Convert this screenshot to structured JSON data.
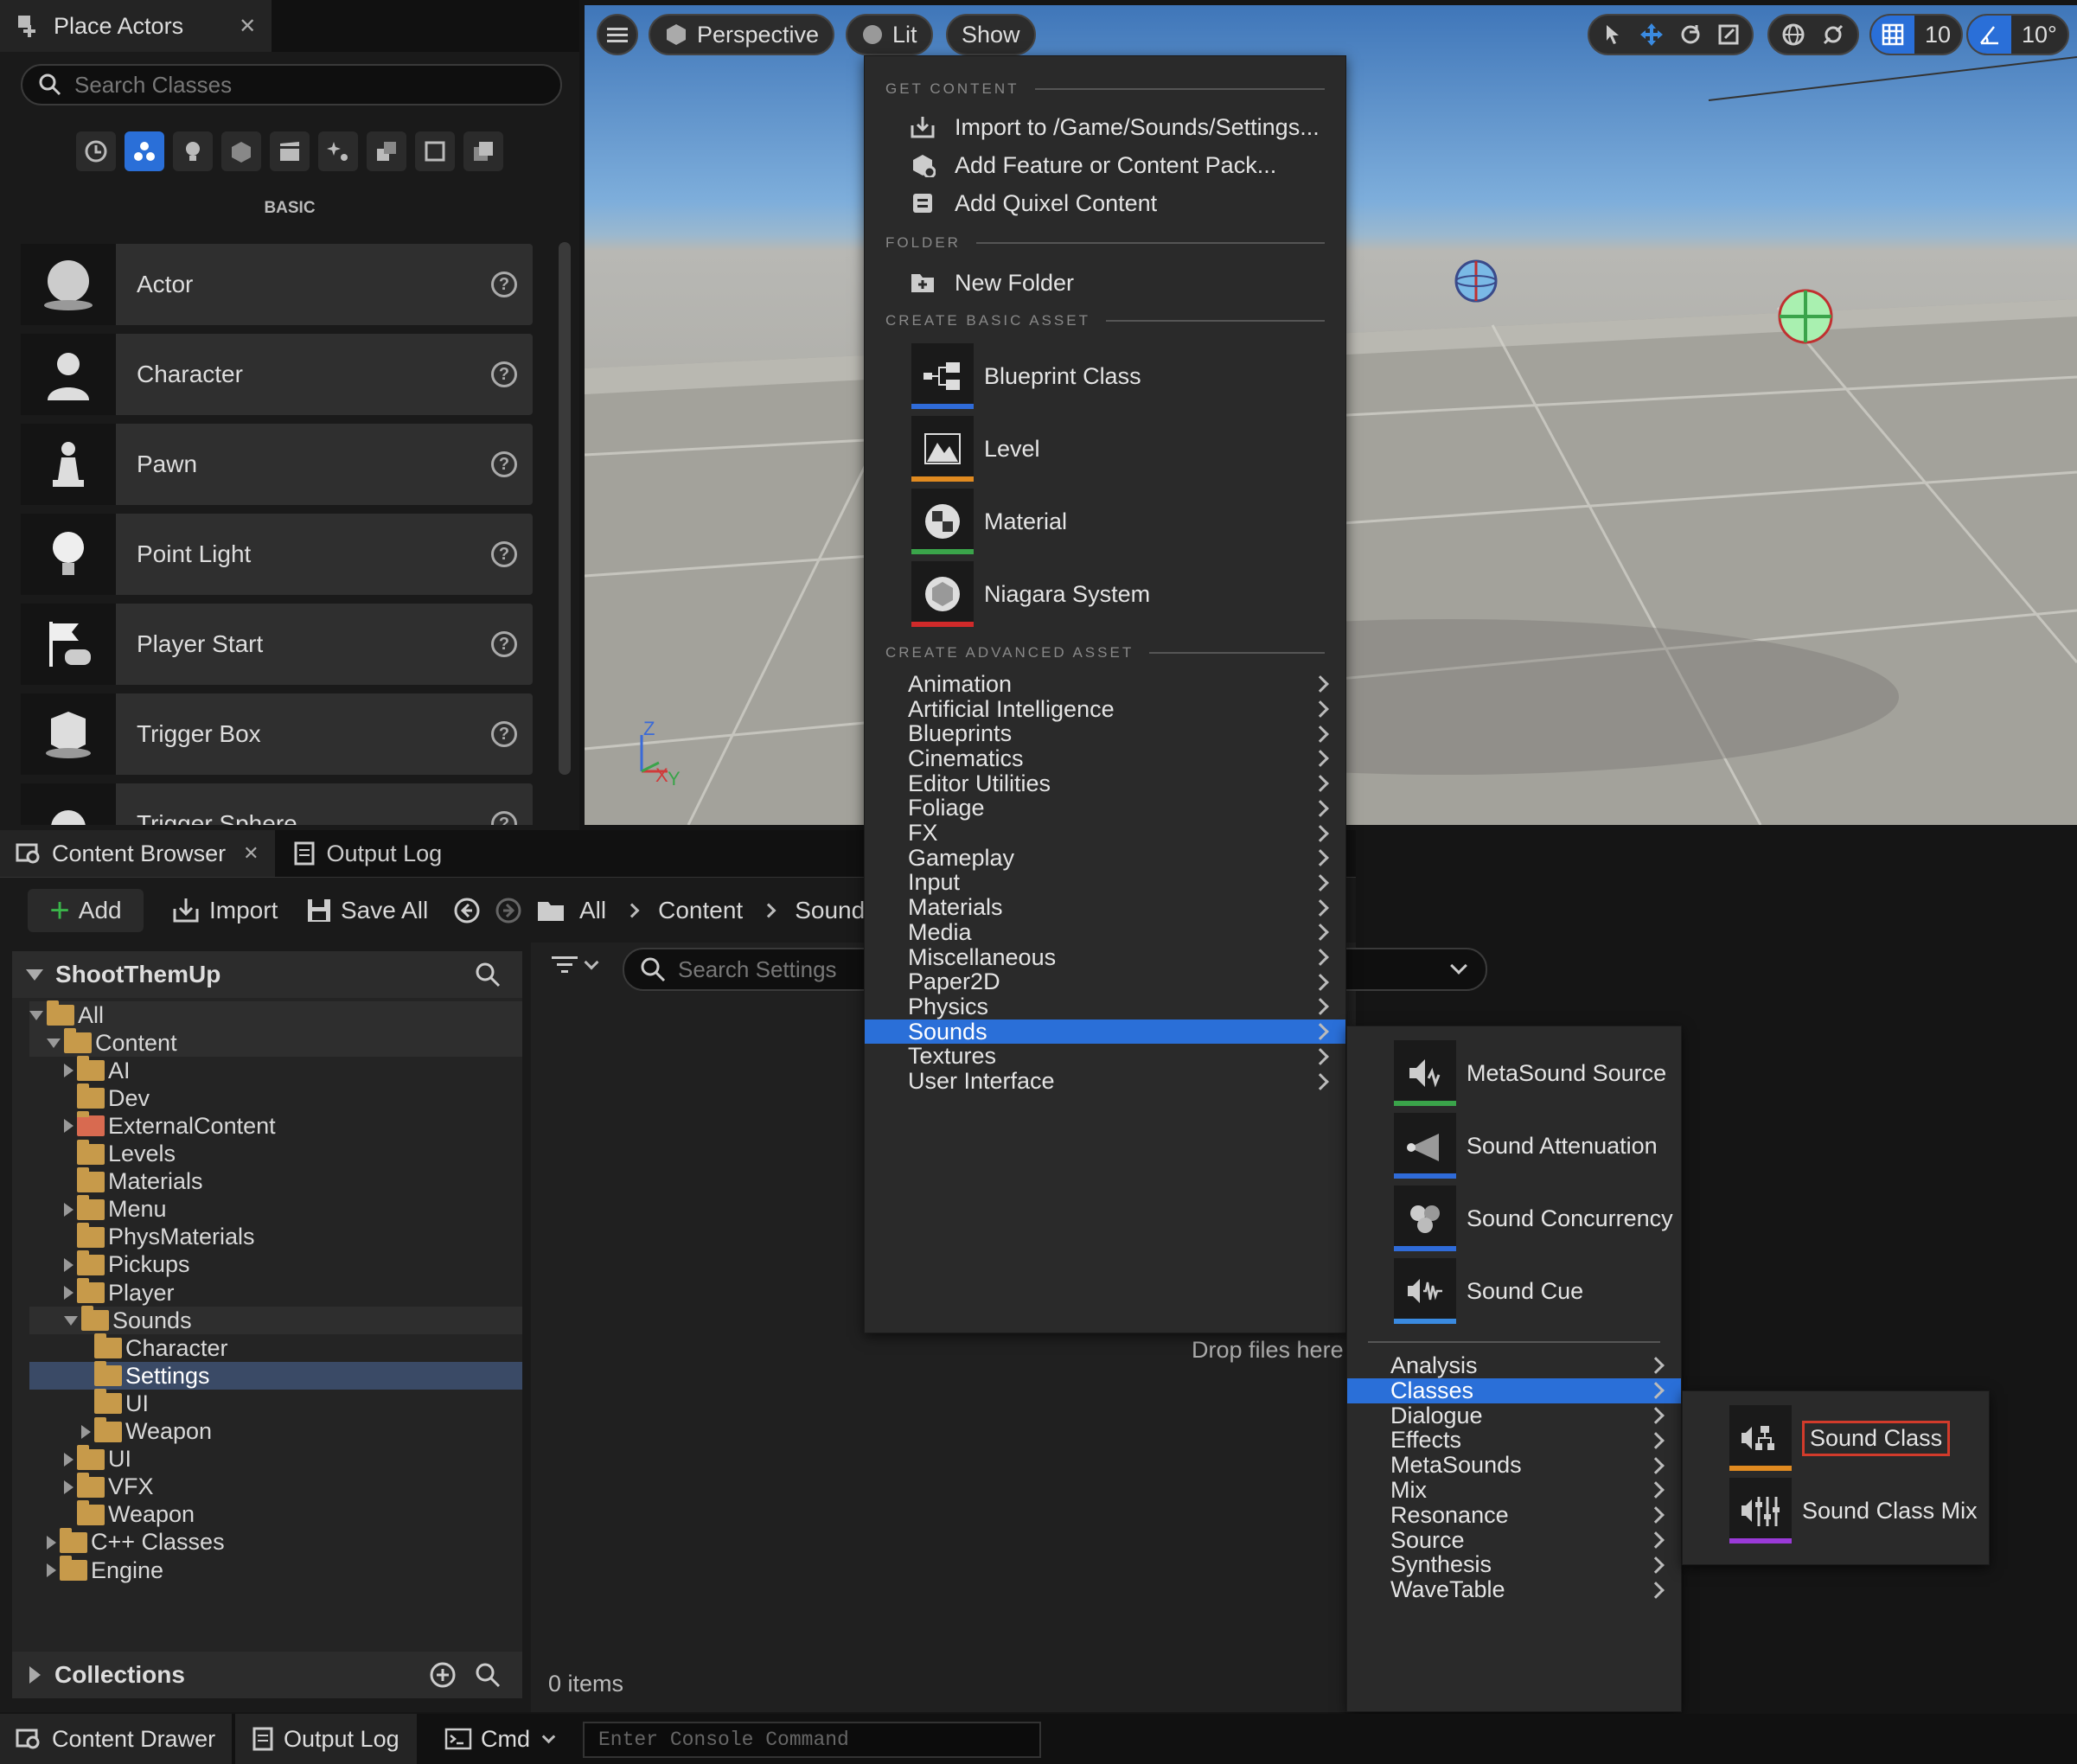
{
  "place_actors": {
    "tab_title": "Place Actors",
    "search_placeholder": "Search Classes",
    "category_label": "BASIC",
    "actors": [
      "Actor",
      "Character",
      "Pawn",
      "Point Light",
      "Player Start",
      "Trigger Box",
      "Trigger Sphere"
    ]
  },
  "viewport": {
    "perspective_label": "Perspective",
    "lit_label": "Lit",
    "show_label": "Show",
    "grid_snap": "10",
    "rotation_snap": "10°",
    "axis_z": "Z",
    "axis_x": "X",
    "axis_y": "Y"
  },
  "content_browser": {
    "tab_title": "Content Browser",
    "output_log_tab": "Output Log",
    "add_label": "Add",
    "import_label": "Import",
    "save_all_label": "Save All",
    "breadcrumb": [
      "All",
      "Content",
      "Sounds"
    ],
    "project_name": "ShootThemUp",
    "search_placeholder": "Search Settings",
    "drop_hint": "Drop files here",
    "items_count": "0 items",
    "collections_label": "Collections",
    "tree": [
      {
        "label": "All",
        "level": 0,
        "open": true
      },
      {
        "label": "Content",
        "level": 1,
        "open": true
      },
      {
        "label": "AI",
        "level": 2,
        "collapsed": true
      },
      {
        "label": "Dev",
        "level": 2
      },
      {
        "label": "ExternalContent",
        "level": 2,
        "collapsed": true
      },
      {
        "label": "Levels",
        "level": 2
      },
      {
        "label": "Materials",
        "level": 2
      },
      {
        "label": "Menu",
        "level": 2,
        "collapsed": true
      },
      {
        "label": "PhysMaterials",
        "level": 2
      },
      {
        "label": "Pickups",
        "level": 2,
        "collapsed": true
      },
      {
        "label": "Player",
        "level": 2,
        "collapsed": true
      },
      {
        "label": "Sounds",
        "level": 2,
        "open": true
      },
      {
        "label": "Character",
        "level": 3
      },
      {
        "label": "Settings",
        "level": 3
      },
      {
        "label": "UI",
        "level": 3
      },
      {
        "label": "Weapon",
        "level": 3,
        "collapsed": true
      },
      {
        "label": "UI",
        "level": 2,
        "collapsed": true
      },
      {
        "label": "VFX",
        "level": 2,
        "collapsed": true
      },
      {
        "label": "Weapon",
        "level": 2
      },
      {
        "label": "C++ Classes",
        "level": 1,
        "collapsed": true
      },
      {
        "label": "Engine",
        "level": 1,
        "collapsed": true
      }
    ]
  },
  "context_menu": {
    "sec_get_content": "GET CONTENT",
    "import_to": "Import to /Game/Sounds/Settings...",
    "add_feature": "Add Feature or Content Pack...",
    "add_quixel": "Add Quixel Content",
    "sec_folder": "FOLDER",
    "new_folder": "New Folder",
    "sec_basic": "CREATE BASIC ASSET",
    "basic_assets": [
      {
        "label": "Blueprint Class",
        "color": "#2f6bd8"
      },
      {
        "label": "Level",
        "color": "#e08a20"
      },
      {
        "label": "Material",
        "color": "#3aa44a"
      },
      {
        "label": "Niagara System",
        "color": "#d02a2a"
      }
    ],
    "sec_advanced": "CREATE ADVANCED ASSET",
    "advanced": [
      "Animation",
      "Artificial Intelligence",
      "Blueprints",
      "Cinematics",
      "Editor Utilities",
      "Foliage",
      "FX",
      "Gameplay",
      "Input",
      "Materials",
      "Media",
      "Miscellaneous",
      "Paper2D",
      "Physics",
      "Sounds",
      "Textures",
      "User Interface"
    ],
    "highlighted": "Sounds"
  },
  "sounds_menu": {
    "assets": [
      {
        "label": "MetaSound Source",
        "color": "#3aa44a"
      },
      {
        "label": "Sound Attenuation",
        "color": "#2f6bd8"
      },
      {
        "label": "Sound Concurrency",
        "color": "#2f6bd8"
      },
      {
        "label": "Sound Cue",
        "color": "#3a8ae0"
      }
    ],
    "submenus": [
      "Analysis",
      "Classes",
      "Dialogue",
      "Effects",
      "MetaSounds",
      "Mix",
      "Resonance",
      "Source",
      "Synthesis",
      "WaveTable"
    ],
    "highlighted": "Classes"
  },
  "classes_menu": {
    "items": [
      {
        "label": "Sound Class",
        "color": "#e08a20"
      },
      {
        "label": "Sound Class Mix",
        "color": "#9a3ad8"
      }
    ]
  },
  "status_bar": {
    "content_drawer": "Content Drawer",
    "output_log": "Output Log",
    "cmd_label": "Cmd",
    "console_placeholder": "Enter Console Command"
  }
}
